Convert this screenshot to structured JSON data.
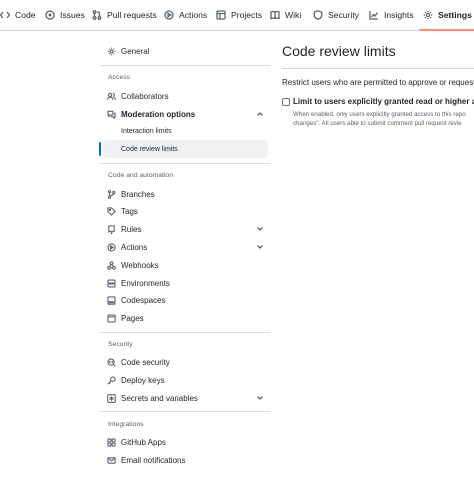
{
  "nav": {
    "tabs": [
      {
        "label": "Code",
        "icon": "code-icon"
      },
      {
        "label": "Issues",
        "icon": "issue-icon"
      },
      {
        "label": "Pull requests",
        "icon": "pull-request-icon"
      },
      {
        "label": "Actions",
        "icon": "play-icon"
      },
      {
        "label": "Projects",
        "icon": "table-icon"
      },
      {
        "label": "Wiki",
        "icon": "book-icon"
      },
      {
        "label": "Security",
        "icon": "shield-icon"
      },
      {
        "label": "Insights",
        "icon": "graph-icon"
      },
      {
        "label": "Settings",
        "icon": "gear-icon"
      }
    ],
    "active_tab": "Settings",
    "active_underline_color": "#fd8c73"
  },
  "sidebar": {
    "general": "General",
    "access_header": "Access",
    "collaborators": "Collaborators",
    "moderation": "Moderation options",
    "interaction_limits": "Interaction limits",
    "code_review_limits": "Code review limits",
    "code_automation_header": "Code and automation",
    "branches": "Branches",
    "tags": "Tags",
    "rules": "Rules",
    "actions": "Actions",
    "webhooks": "Webhooks",
    "environments": "Environments",
    "codespaces": "Codespaces",
    "pages": "Pages",
    "security_header": "Security",
    "code_security": "Code security",
    "deploy_keys": "Deploy keys",
    "secrets": "Secrets and variables",
    "integrations_header": "Integrations",
    "github_apps": "GitHub Apps",
    "email_notifications": "Email notifications",
    "selected_item": "Code review limits",
    "selected_color": "#0969da"
  },
  "main": {
    "title": "Code review limits",
    "description": "Restrict users who are permitted to approve or request c",
    "checkbox_label": "Limit to users explicitly granted read or higher acce",
    "checkbox_checked": false,
    "help_line1": "When enabled, only users explicitly granted access to this repo",
    "help_line2": "changes\". All users able to submit comment pull request revie"
  }
}
